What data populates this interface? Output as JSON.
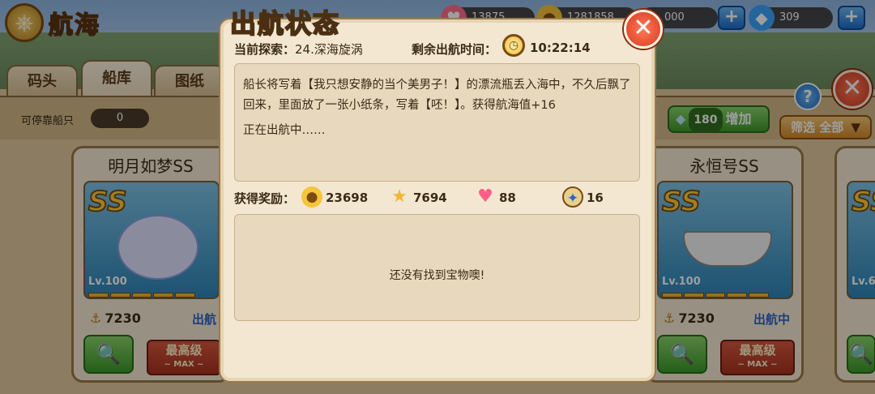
{
  "header": {
    "title": "航海",
    "coins": "13875",
    "gold": "1281858",
    "partial": "000",
    "gems": "309"
  },
  "tabs": [
    {
      "label": "码头"
    },
    {
      "label": "船库"
    },
    {
      "label": "图纸"
    }
  ],
  "dock": {
    "label": "可停靠船只",
    "count": "0",
    "gem_value": "180",
    "gem_add_label": "增加",
    "filter_label": "筛选",
    "filter_value": "全部"
  },
  "cards": [
    {
      "name": "明月如梦SS",
      "grade": "SS",
      "level": "Lv.100",
      "score": "7230",
      "status": "出航",
      "max_label": "最高级",
      "max_sub": "~ MAX ~"
    },
    {
      "name": "永恒号SS",
      "grade": "SS",
      "level": "Lv.100",
      "score": "7230",
      "status": "出航中",
      "max_label": "最高级",
      "max_sub": "~ MAX ~"
    },
    {
      "name": "",
      "grade": "SS",
      "level": "Lv.6",
      "score": "",
      "status": "",
      "max_label": "",
      "max_sub": ""
    }
  ],
  "modal": {
    "title": "出航状态",
    "explore_label": "当前探索：",
    "explore_value": "24.深海旋涡",
    "time_label": "剩余出航时间：",
    "time_value": "10:22:14",
    "message": "船长将写着【我只想安静的当个美男子！】的漂流瓶丢入海中，不久后飘了回来，里面放了一张小纸条，写着【呸！】。获得航海值+16",
    "status_text": "正在出航中……",
    "rewards_label": "获得奖励：",
    "rewards": [
      {
        "icon": "gold-coin-icon",
        "value": "23698"
      },
      {
        "icon": "star-icon",
        "value": "7694"
      },
      {
        "icon": "heart-icon",
        "value": "88"
      },
      {
        "icon": "compass-icon",
        "value": "16"
      }
    ],
    "treasure_text": "还没有找到宝物噢!"
  },
  "colors": {
    "panel": "#f3e7d2",
    "inner": "#e8d9be",
    "close": "#d83a1f",
    "green_button": "#3d9a2a",
    "status_blue": "#2a64c8"
  }
}
